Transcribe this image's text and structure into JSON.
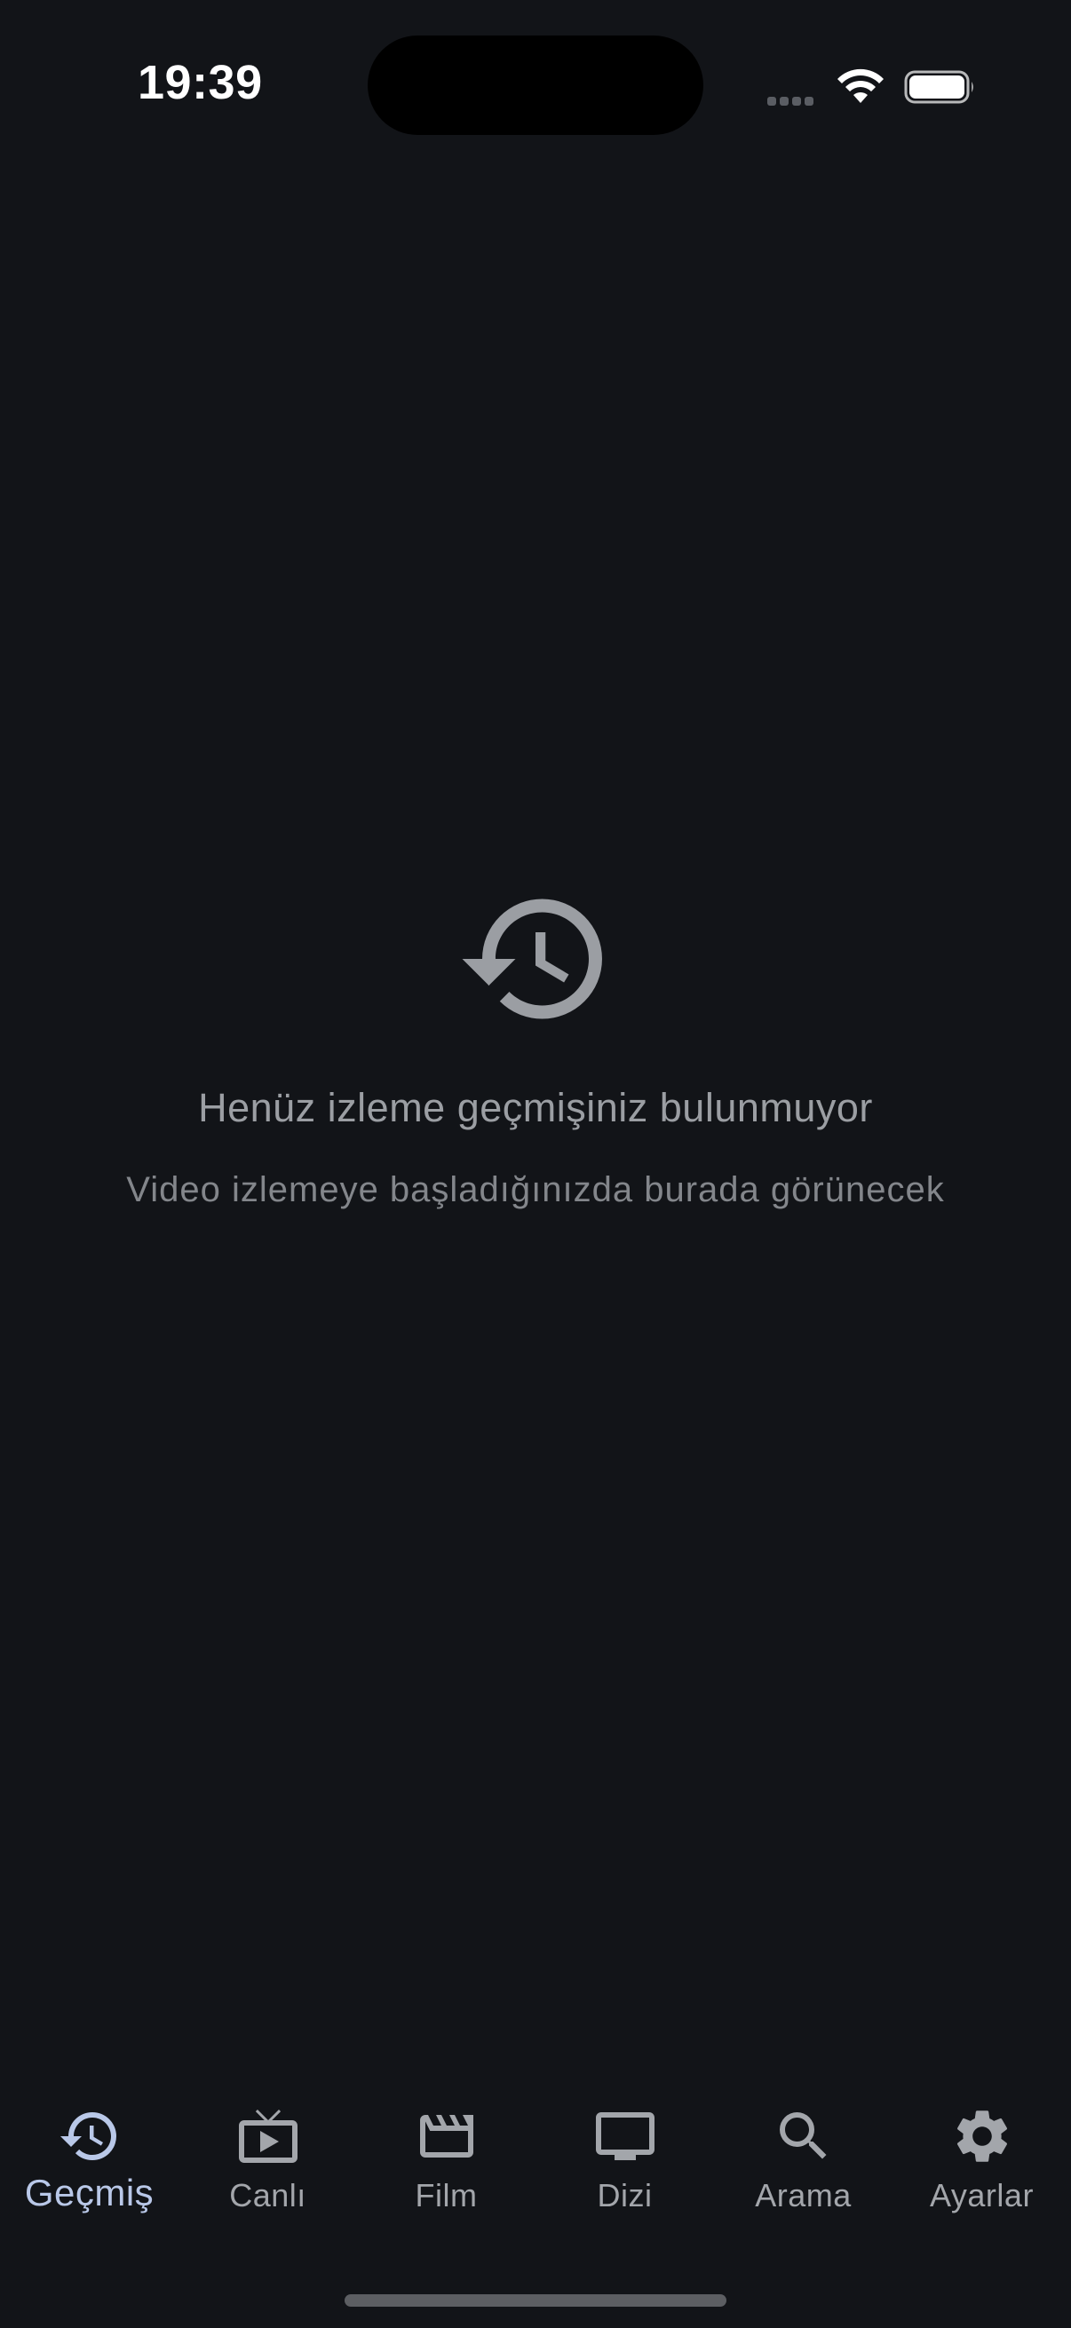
{
  "status_bar": {
    "time": "19:39"
  },
  "empty_state": {
    "icon": "history-icon",
    "title": "Henüz izleme geçmişiniz bulunmuyor",
    "subtitle": "Video izlemeye başladığınızda burada görünecek"
  },
  "bottom_nav": {
    "active_index": 0,
    "items": [
      {
        "label": "Geçmiş",
        "icon": "history-icon"
      },
      {
        "label": "Canlı",
        "icon": "live-tv-icon"
      },
      {
        "label": "Film",
        "icon": "movie-clapper-icon"
      },
      {
        "label": "Dizi",
        "icon": "tv-icon"
      },
      {
        "label": "Arama",
        "icon": "search-icon"
      },
      {
        "label": "Ayarlar",
        "icon": "gear-icon"
      }
    ]
  },
  "colors": {
    "background": "#121418",
    "active_nav": "#b9c8e8",
    "inactive_nav": "#a3a6ab",
    "empty_icon": "#9b9ea3"
  }
}
